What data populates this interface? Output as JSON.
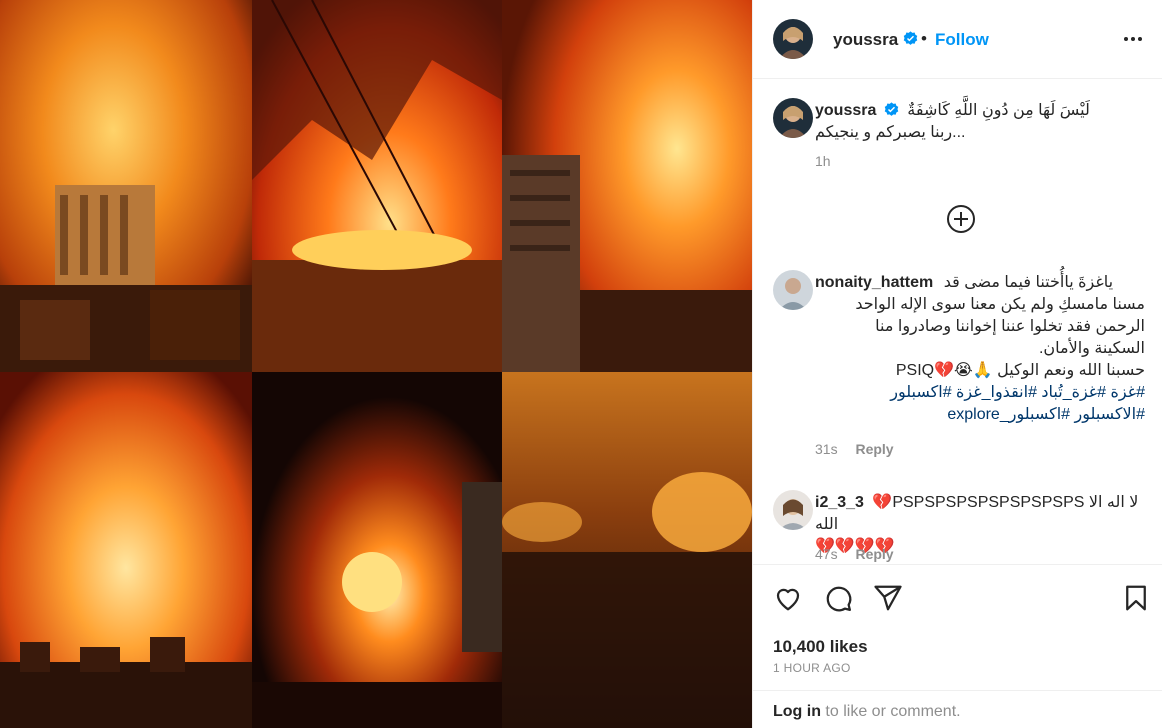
{
  "post": {
    "author": "youssra",
    "follow_label": "Follow",
    "separator": "•",
    "more_icon": "more-horizontal-icon",
    "caption_line1": "لَيْسَ لَهَا مِن دُونِ اللَّهِ كَاشِفَةٌ",
    "caption_line2": "ربنا يصبركم و ينجيكم...",
    "caption_time": "1h",
    "load_more_icon": "plus-circle-icon",
    "likes": "10,400 likes",
    "time_ago": "1 HOUR AGO",
    "login_link": "Log in",
    "login_rest": " to like or comment."
  },
  "comments": [
    {
      "username": "nonaity_hattem",
      "lines": [
        "ياغزةَ ياأُختنا فيما مضى قد",
        "مسنا مامسكِ ولم يكن معنا سوى الإله الواحد",
        "الرحمن فقد تخلوا عننا إخواننا وصادروا منا",
        "السكينة والأمان.",
        "حسبنا الله ونعم الوكيل 🙏😭💔PSIQ"
      ],
      "hashtags_line1": "#غزة #غزة_تُباد #انقذوا_غزة #اكسبلور",
      "hashtags_line2": "#الاكسبلور #اكسبلور_explore",
      "time": "31s",
      "reply": "Reply"
    },
    {
      "username": "i2_3_3",
      "text_line1": "💔PSPSPSPSPSPSPSPSPS لا اله الا الله",
      "text_line2": "💔💔💔💔",
      "time": "47s",
      "reply": "Reply"
    }
  ],
  "colors": {
    "link_blue": "#0095f6",
    "hashtag": "#00376b",
    "muted": "#8e8e8e",
    "text": "#262626",
    "border": "#efefef"
  },
  "icons": {
    "like": "heart-outline-icon",
    "comment": "comment-bubble-icon",
    "share": "paper-plane-icon",
    "save": "bookmark-icon",
    "verified": "verified-badge-icon"
  }
}
